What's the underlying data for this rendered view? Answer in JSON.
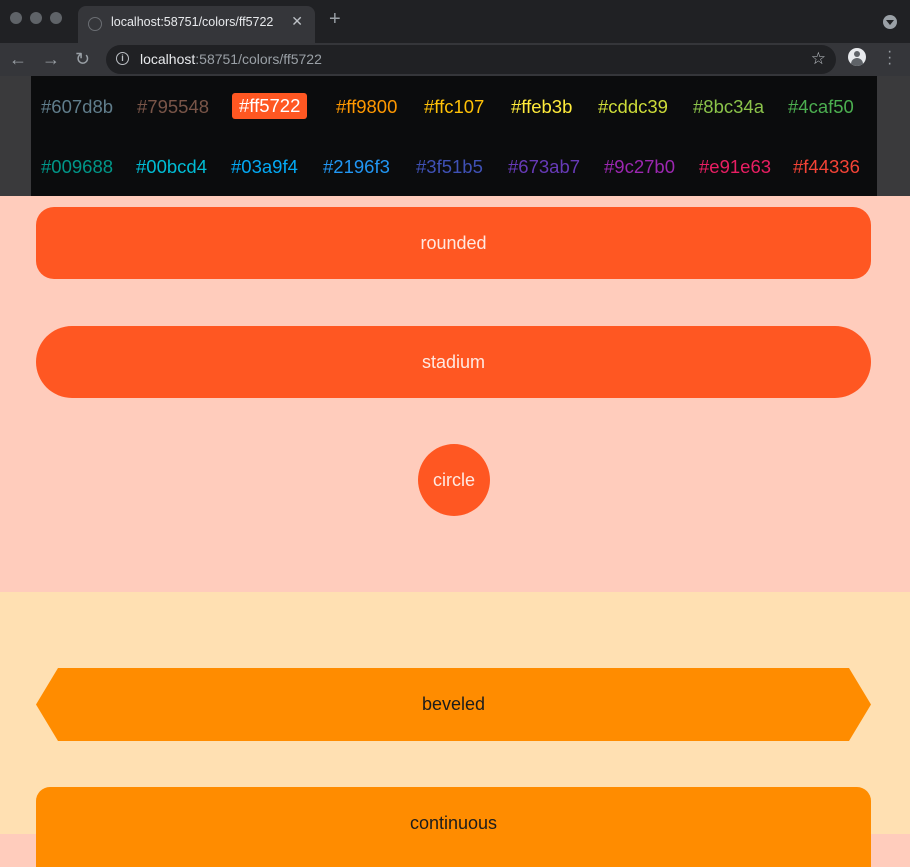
{
  "browser": {
    "tab_title": "localhost:58751/colors/ff5722",
    "url_host": "localhost",
    "url_path": ":58751/colors/ff5722"
  },
  "palette": {
    "selected": "#ff5722",
    "rows": [
      [
        {
          "label": "#607d8b",
          "color": "#607d8b"
        },
        {
          "label": "#795548",
          "color": "#795548"
        },
        {
          "label": "#ff5722",
          "color": "#ff5722"
        },
        {
          "label": "#ff9800",
          "color": "#ff9800"
        },
        {
          "label": "#ffc107",
          "color": "#ffc107"
        },
        {
          "label": "#ffeb3b",
          "color": "#ffeb3b"
        },
        {
          "label": "#cddc39",
          "color": "#cddc39"
        },
        {
          "label": "#8bc34a",
          "color": "#8bc34a"
        },
        {
          "label": "#4caf50",
          "color": "#4caf50"
        }
      ],
      [
        {
          "label": "#009688",
          "color": "#009688"
        },
        {
          "label": "#00bcd4",
          "color": "#00bcd4"
        },
        {
          "label": "#03a9f4",
          "color": "#03a9f4"
        },
        {
          "label": "#2196f3",
          "color": "#2196f3"
        },
        {
          "label": "#3f51b5",
          "color": "#3f51b5"
        },
        {
          "label": "#673ab7",
          "color": "#673ab7"
        },
        {
          "label": "#9c27b0",
          "color": "#9c27b0"
        },
        {
          "label": "#e91e63",
          "color": "#e91e63"
        },
        {
          "label": "#f44336",
          "color": "#f44336"
        }
      ]
    ]
  },
  "buttons": {
    "rounded": "rounded",
    "stadium": "stadium",
    "circle": "circle",
    "beveled": "beveled",
    "continuous": "continuous"
  }
}
